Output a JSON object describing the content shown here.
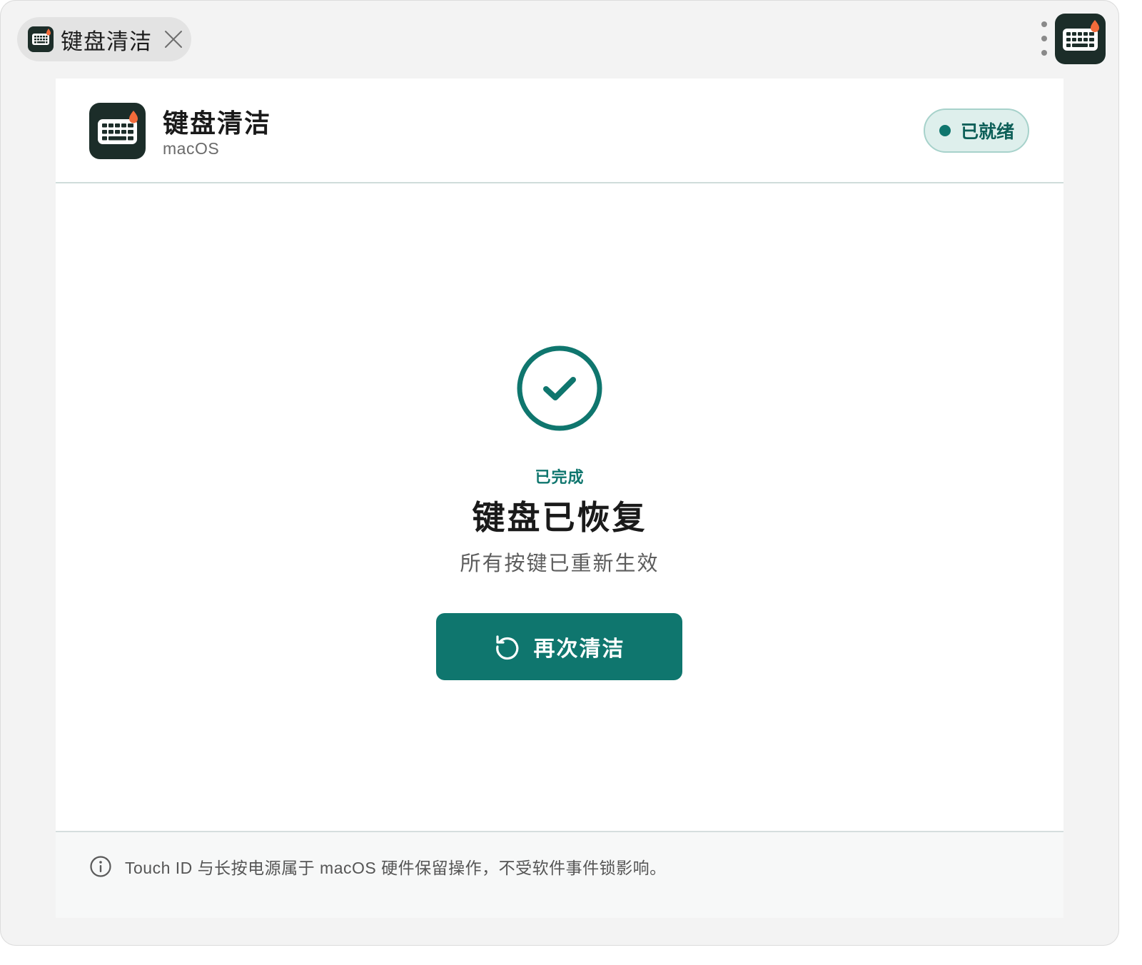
{
  "tab": {
    "title": "键盘清洁",
    "icon": "keyboard-icon"
  },
  "toolbar": {
    "more_icon": "more-vertical-icon",
    "app_icon": "keyboard-icon"
  },
  "header": {
    "title": "键盘清洁",
    "subtitle": "macOS",
    "status": "已就绪"
  },
  "main": {
    "icon": "check-circle-icon",
    "done_label": "已完成",
    "title": "键盘已恢复",
    "subtitle": "所有按键已重新生效",
    "button_label": "再次清洁",
    "button_icon": "refresh-icon"
  },
  "footer": {
    "icon": "info-icon",
    "note": "Touch ID 与长按电源属于 macOS 硬件保留操作，不受软件事件锁影响。"
  },
  "colors": {
    "accent": "#0f766e",
    "icon_bg": "#1c2d29",
    "badge_bg": "#deefec",
    "flame": "#f26b3a"
  }
}
